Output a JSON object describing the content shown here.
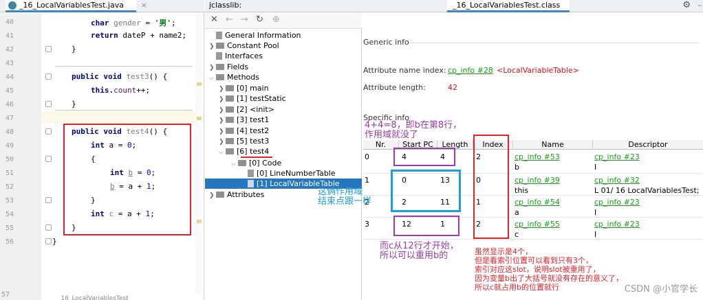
{
  "editor": {
    "tab_label": "_16_LocalVariablesTest.java",
    "bottom_label": "_16_LocalVariablesTest",
    "line_numbers": [
      "40",
      "41",
      "42",
      "43",
      "44",
      "45",
      "46",
      "47",
      "48",
      "49",
      "50",
      "51",
      "52",
      "53",
      "54",
      "55",
      "56",
      "57"
    ],
    "code": {
      "l40a": "char ",
      "l40b": "gender",
      "l40c": " = ",
      "l40d": "'男'",
      "l40e": ";",
      "l41a": "return ",
      "l41b": "dateP + name2;",
      "close": "}",
      "l44a": "public void ",
      "l44b": "test3",
      "l44c": "() {",
      "l45a": "this.",
      "l45b": "count",
      "l45c": "++;",
      "l48a": "public void ",
      "l48b": "test4",
      "l48c": "() {",
      "l49a": "int ",
      "l49b": "a = ",
      "l49c": "0",
      "l49d": ";",
      "open": "{",
      "l51a": "int ",
      "l51b": "b",
      "l51c": " = ",
      "l51d": "0",
      "l51e": ";",
      "l52a": "b",
      "l52b": " = a + ",
      "l52c": "1",
      "l52d": ";",
      "l54a": "int ",
      "l54b": "c",
      "l54c": " = a + ",
      "l54d": "1",
      "l54e": ";"
    }
  },
  "jclasslib": {
    "tab1": "jclasslib:",
    "tab2": "_16_LocalVariablesTest.class",
    "tree": {
      "general": "General Information",
      "pool": "Constant Pool",
      "interfaces": "Interfaces",
      "fields": "Fields",
      "methods": "Methods",
      "m0": "[0] main",
      "m1": "[1] testStatic",
      "m2": "[2] <init>",
      "m3": "[3] test1",
      "m4": "[4] test2",
      "m5": "[5] test3",
      "m6": "[6] test4",
      "code": "[0] Code",
      "lnt": "[0] LineNumberTable",
      "lvt": "[1] LocalVariableTable",
      "attributes": "Attributes"
    }
  },
  "details": {
    "generic_title": "Generic info",
    "attr_name_label": "Attribute name index:",
    "attr_name_link": "cp_info #28",
    "attr_name_value": "<LocalVariableTable>",
    "attr_len_label": "Attribute length:",
    "attr_len_value": "42",
    "specific_title": "Specific info",
    "headers": {
      "nr": "Nr.",
      "start": "Start PC",
      "length": "Length",
      "index": "Index",
      "name": "Name",
      "desc": "Descriptor"
    },
    "rows": [
      {
        "nr": "0",
        "start": "4",
        "length": "4",
        "index": "2",
        "name_link": "cp_info #53",
        "name": "b",
        "desc_link": "cp_info #23",
        "desc": "I"
      },
      {
        "nr": "1",
        "start": "0",
        "length": "13",
        "index": "0",
        "name_link": "cp_info #39",
        "name": "this",
        "desc_link": "cp_info #32",
        "desc": "L 01/ 16 LocalVariablesTest;"
      },
      {
        "nr": "2",
        "start": "2",
        "length": "11",
        "index": "1",
        "name_link": "cp_info #54",
        "name": "a",
        "desc_link": "cp_info #23",
        "desc": "I"
      },
      {
        "nr": "3",
        "start": "12",
        "length": "1",
        "index": "2",
        "name_link": "cp_info #55",
        "name": "c",
        "desc_link": "cp_info #23",
        "desc": "I"
      }
    ]
  },
  "annotations": {
    "a1_line1": "4+4=8，即b在第8行，",
    "a1_line2": "作用域就没了",
    "a2_line1": "这俩作用域",
    "a2_line2": "结束点跟一样",
    "a3_line1": "而c从12行才开始，",
    "a3_line2": "所以可以重用b的",
    "a4_line1": "虽然显示是4个，",
    "a4_line2": "但是看索引位置可以看到只有3个，",
    "a4_line3": "索引对应这slot，说明slot被重用了，",
    "a4_line4": "因为变量b出了大括号就没有存在的意义了，",
    "a4_line5": "所以c就占用b的位置就行"
  },
  "watermark": "CSDN @小官学长",
  "colors": {
    "annotation_red": "#e8202a",
    "annotation_purple": "#9b3aa8",
    "annotation_blue": "#1a9fe0",
    "selection": "#2675bf",
    "link_green": "#1b9d1b"
  }
}
